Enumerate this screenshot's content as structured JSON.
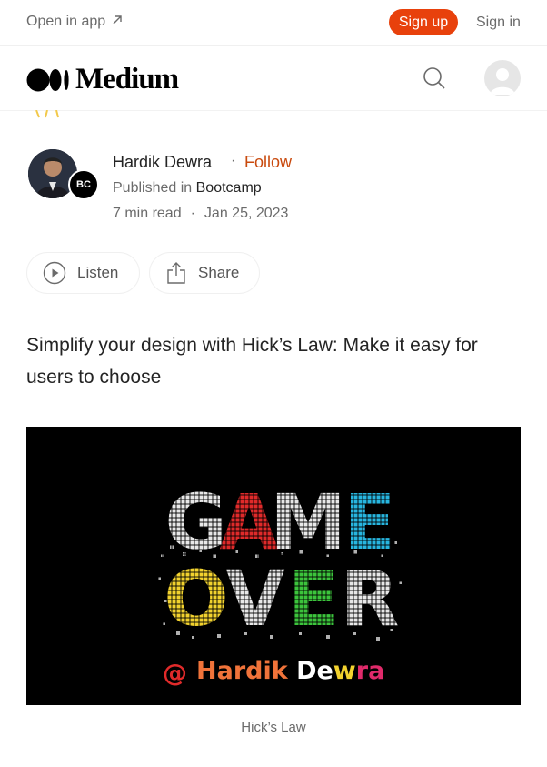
{
  "topbar": {
    "open_in_app": "Open in app",
    "sign_up": "Sign up",
    "sign_in": "Sign in"
  },
  "brand": {
    "name": "Medium"
  },
  "author": {
    "name": "Hardik Dewra",
    "separator": "·",
    "follow": "Follow",
    "published_prefix": "Published in",
    "publication": "Bootcamp",
    "publication_badge": "BC",
    "read_time": "7 min read",
    "meta_separator": "·",
    "date": "Jan 25, 2023"
  },
  "actions": {
    "listen": "Listen",
    "share": "Share"
  },
  "article": {
    "subtitle": "Simplify your design with Hick’s Law: Make it easy for users to choose"
  },
  "hero": {
    "word1_letters": [
      "G",
      "A",
      "M",
      "E"
    ],
    "word2_letters": [
      "O",
      "V",
      "E",
      "R"
    ],
    "credit_at": "@",
    "credit_name_parts": [
      "Hardik",
      " De",
      "w",
      "ra"
    ],
    "caption": "Hick’s Law"
  },
  "colors": {
    "accent_signup": "#e8410c",
    "follow": "#c94a0e",
    "game_G": "#e8e8e8",
    "game_A": "#e02a2a",
    "game_M": "#e8e8e8",
    "game_E": "#27b6e0",
    "over_O": "#f2d22e",
    "over_V": "#e8e8e8",
    "over_E": "#3cc43c",
    "over_R": "#e8e8e8"
  },
  "icons": [
    "arrow-up-right-icon",
    "medium-logo-icon",
    "search-icon",
    "default-avatar-icon",
    "play-icon",
    "share-icon"
  ]
}
